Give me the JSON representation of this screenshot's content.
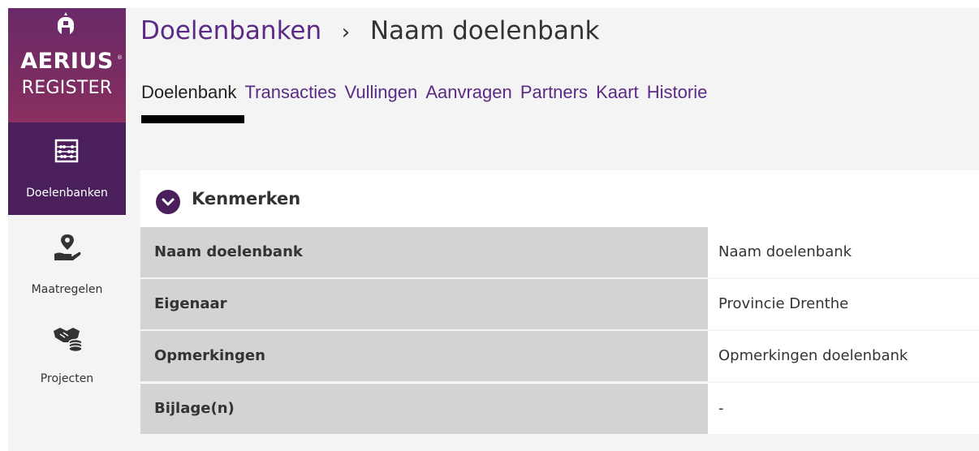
{
  "brand": {
    "name": "AERIUS",
    "registered_mark": "®",
    "product": "REGISTER"
  },
  "sidebar": {
    "items": [
      {
        "label": "Doelenbanken",
        "icon": "abacus-icon",
        "active": true
      },
      {
        "label": "Maatregelen",
        "icon": "hand-location-pin-icon",
        "active": false
      },
      {
        "label": "Projecten",
        "icon": "handshake-coins-icon",
        "active": false
      }
    ]
  },
  "breadcrumb": {
    "parent": "Doelenbanken",
    "separator": "›",
    "current": "Naam doelenbank"
  },
  "tabs": [
    {
      "label": "Doelenbank",
      "active": true
    },
    {
      "label": "Transacties",
      "active": false
    },
    {
      "label": "Vullingen",
      "active": false
    },
    {
      "label": "Aanvragen",
      "active": false
    },
    {
      "label": "Partners",
      "active": false
    },
    {
      "label": "Kaart",
      "active": false
    },
    {
      "label": "Historie",
      "active": false
    }
  ],
  "panel": {
    "title": "Kenmerken",
    "rows": [
      {
        "label": "Naam doelenbank",
        "value": "Naam doelenbank"
      },
      {
        "label": "Eigenaar",
        "value": "Provincie Drenthe"
      },
      {
        "label": "Opmerkingen",
        "value": "Opmerkingen doelenbank"
      },
      {
        "label": "Bijlage(n)",
        "value": "-"
      }
    ]
  },
  "colors": {
    "accent": "#5b2a86",
    "sidebar_active": "#4a1f5c",
    "label_bg": "#d3d3d3",
    "page_bg": "#f4f4f4"
  }
}
